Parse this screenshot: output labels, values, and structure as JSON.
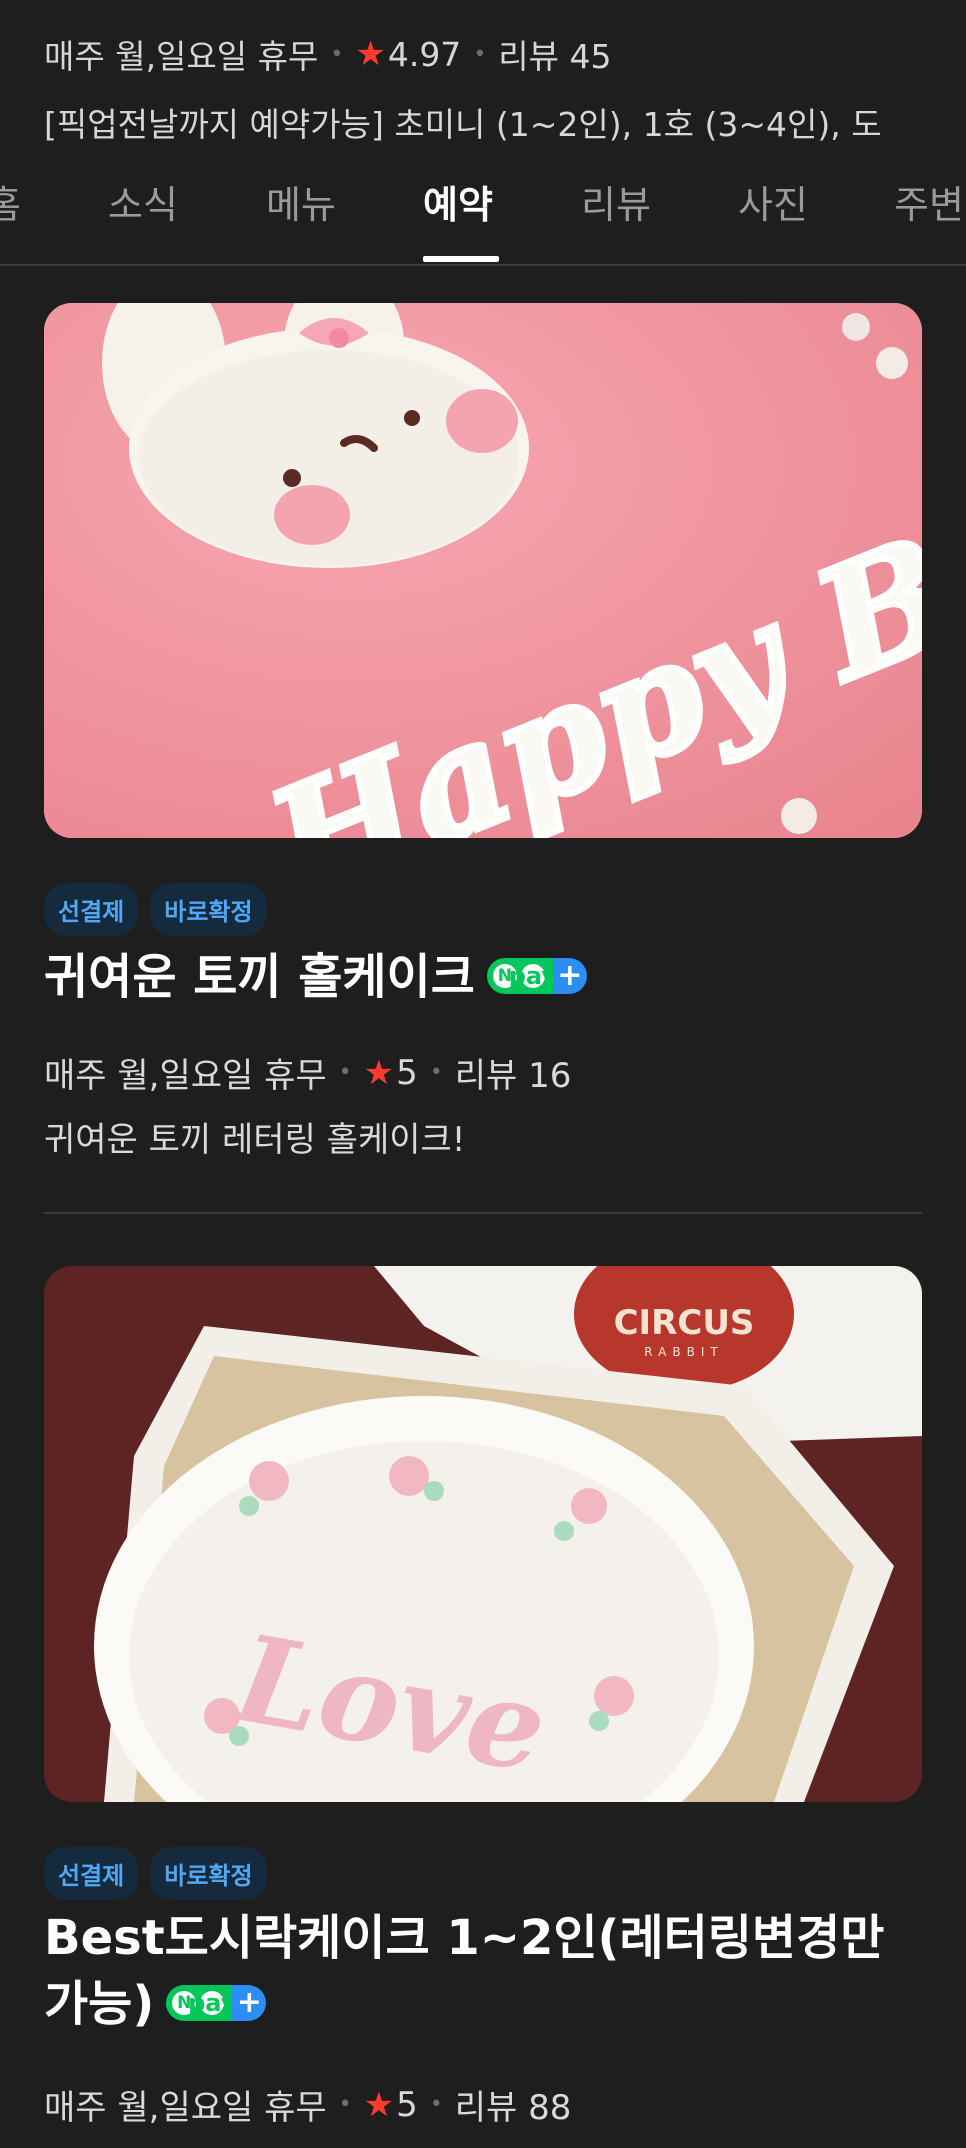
{
  "header": {
    "holiday": "매주 월,일요일 휴무",
    "rating": "4.97",
    "reviews": "리뷰 45",
    "description": "[픽업전날까지 예약가능] 초미니 (1~2인), 1호 (3~4인), 도"
  },
  "tabs": [
    {
      "label": "홈"
    },
    {
      "label": "소식"
    },
    {
      "label": "메뉴"
    },
    {
      "label": "예약"
    },
    {
      "label": "리뷰"
    },
    {
      "label": "사진"
    },
    {
      "label": "주변"
    }
  ],
  "products": [
    {
      "image_text": "Happy Birthday",
      "tags": [
        "선결제",
        "바로확정"
      ],
      "title": "귀여운 토끼 홀케이크",
      "npay": "pay",
      "holiday": "매주 월,일요일 휴무",
      "rating": "5",
      "reviews": "리뷰 16",
      "description": "귀여운 토끼 레터링 홀케이크!"
    },
    {
      "image_text": "Love",
      "brand_text": "CIRCUS",
      "brand_sub": "RABBIT",
      "tags": [
        "선결제",
        "바로확정"
      ],
      "title": "Best도시락케이크 1~2인(레터링변경만가능)",
      "npay": "pay",
      "holiday": "매주 월,일요일 휴무",
      "rating": "5",
      "reviews": "리뷰 88"
    }
  ],
  "colors": {
    "background": "#1e1e1f",
    "star": "#ff3b2e",
    "tag_text": "#4fa7f5",
    "npay_green": "#03c75a",
    "npay_blue": "#2c8df5"
  }
}
